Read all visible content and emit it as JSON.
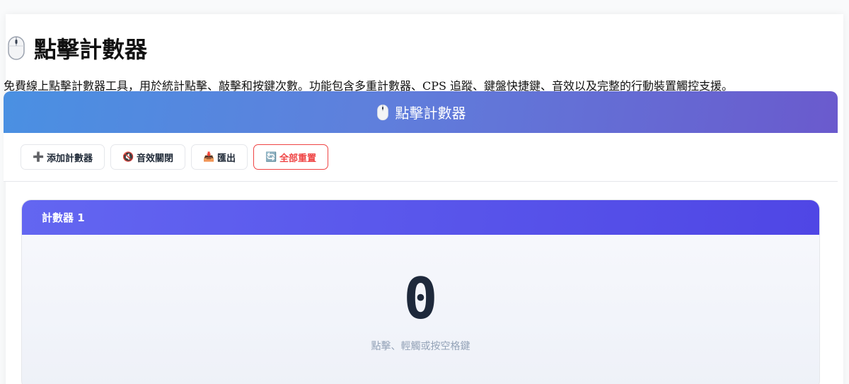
{
  "page": {
    "title": "點擊計數器",
    "intro": "免費線上點擊計數器工具，用於統計點擊、敲擊和按鍵次數。功能包含多重計數器、CPS 追蹤、鍵盤快捷鍵、音效以及完整的行動裝置觸控支援。"
  },
  "banner": {
    "title": "點擊計數器"
  },
  "toolbar": {
    "add": {
      "icon": "➕",
      "label": "添加計數器"
    },
    "sound": {
      "icon": "🔇",
      "label": "音效關閉"
    },
    "export": {
      "icon": "📥",
      "label": "匯出"
    },
    "reset": {
      "icon": "🔄",
      "label": "全部重置"
    }
  },
  "counter": {
    "name": "計數器 1",
    "value": "0",
    "hint": "點擊、輕觸或按空格鍵"
  },
  "colors": {
    "banner_start": "#4a90e2",
    "banner_end": "#6a5acd",
    "counter_header_start": "#6366f1",
    "counter_header_end": "#4f46e5",
    "danger": "#ef4444"
  },
  "icons": [
    "computer-mouse-icon",
    "plus-icon",
    "muted-speaker-icon",
    "download-tray-icon",
    "refresh-icon"
  ]
}
